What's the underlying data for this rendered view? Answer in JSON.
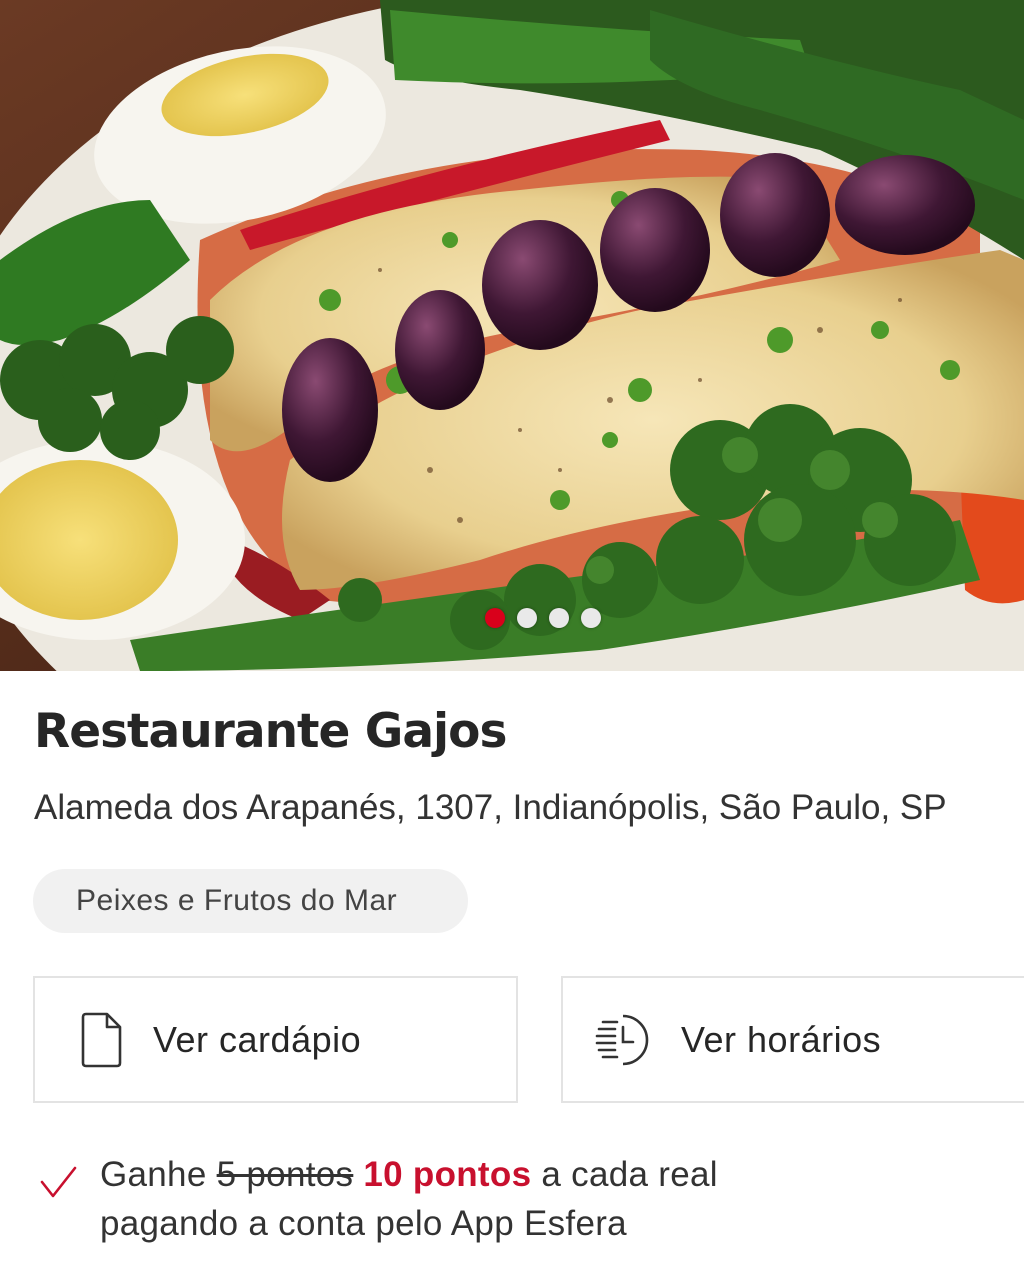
{
  "restaurant": {
    "name": "Restaurante Gajos",
    "address": "Alameda dos Arapanés, 1307, Indianópolis, São Paulo, SP",
    "category": "Peixes e Frutos do Mar"
  },
  "carousel": {
    "slide_count": 4,
    "active_index": 0,
    "image_icon": "food-photo"
  },
  "actions": {
    "menu": {
      "label": "Ver cardápio",
      "icon": "document-icon"
    },
    "hours": {
      "label": "Ver horários",
      "icon": "clock-schedule-icon"
    }
  },
  "points": {
    "prefix": "Ganhe",
    "old_points": "5 pontos",
    "new_points": "10 pontos",
    "suffix_line1": "a cada real",
    "line2": "pagando a conta pelo App Esfera",
    "icon": "check-icon"
  },
  "colors": {
    "accent": "#c8102e",
    "active_dot": "#d9001b",
    "border": "#e3e3e3",
    "chip_bg": "#f1f1f1"
  }
}
